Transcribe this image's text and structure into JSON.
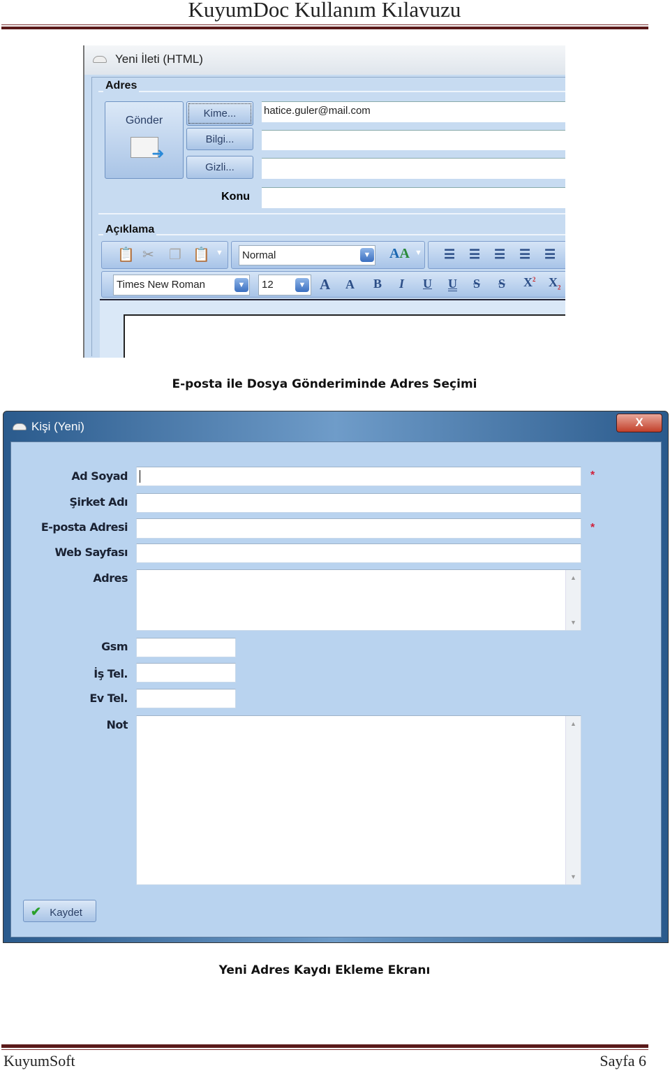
{
  "header": {
    "title": "KuyumDoc Kullanım Kılavuzu"
  },
  "email_window": {
    "title": "Yeni İleti (HTML)",
    "address_group": "Adres",
    "send_button": "Gönder",
    "to_button": "Kime...",
    "cc_button": "Bilgi...",
    "bcc_button": "Gizli...",
    "to_value": "hatice.guler@mail.com",
    "subject_label": "Konu",
    "description_group": "Açıklama",
    "style_value": "Normal",
    "font_value": "Times New Roman",
    "size_value": "12"
  },
  "caption1": "E-posta ile Dosya Gönderiminde Adres Seçimi",
  "contact_window": {
    "title": "Kişi (Yeni)",
    "close": "X",
    "fields": {
      "name": "Ad Soyad",
      "company": "Şirket Adı",
      "email": "E-posta Adresi",
      "web": "Web Sayfası",
      "address": "Adres",
      "gsm": "Gsm",
      "work_phone": "İş Tel.",
      "home_phone": "Ev Tel.",
      "note": "Not"
    },
    "required_mark": "*",
    "save_button": "Kaydet"
  },
  "caption2": "Yeni Adres Kaydı Ekleme Ekranı",
  "footer": {
    "left": "KuyumSoft",
    "right": "Sayfa 6"
  }
}
